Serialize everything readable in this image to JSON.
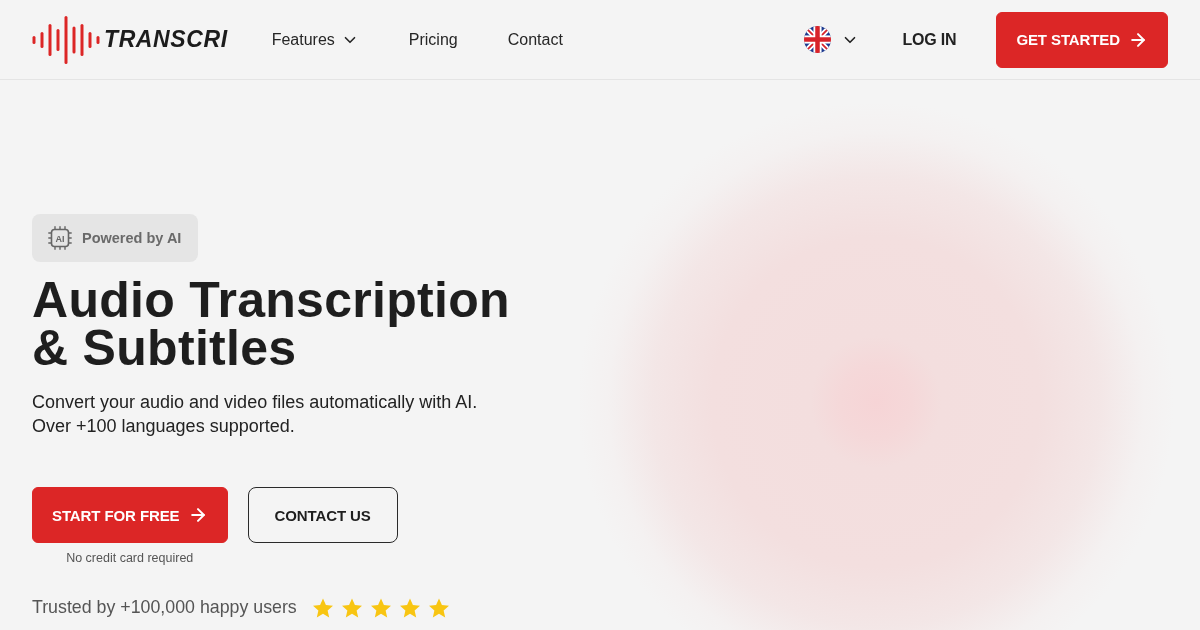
{
  "header": {
    "brand": {
      "name": "TRANSCRI"
    },
    "nav": [
      {
        "label": "Features",
        "kind": "dropdown"
      },
      {
        "label": "Pricing",
        "kind": "link"
      },
      {
        "label": "Contact",
        "kind": "link"
      }
    ],
    "login": "LOG IN",
    "cta": "GET STARTED"
  },
  "hero": {
    "badge": {
      "icon_text": "AI",
      "label": "Powered by AI"
    },
    "title_lines": [
      "Audio Transcription",
      "& Subtitles"
    ],
    "description_lines": [
      "Convert your audio and video files automatically with AI.",
      "Over +100 languages supported."
    ],
    "actions": [
      {
        "label": "START FOR FREE",
        "kind": "primary"
      },
      {
        "label": "CONTACT US",
        "kind": "outline"
      }
    ],
    "note": "No credit card required",
    "trust": {
      "text": "Trusted by +100,000 happy users",
      "stars": 5
    }
  }
}
